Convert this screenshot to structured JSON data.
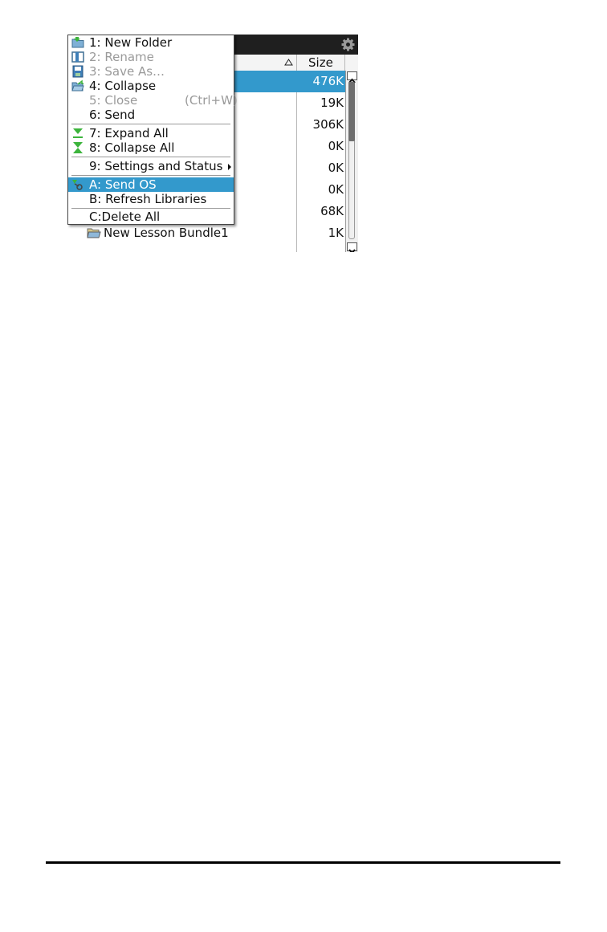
{
  "file_list": {
    "columns": {
      "size_header": "Size",
      "sort_indicator": "ascending"
    },
    "rows": [
      {
        "name": "",
        "size": "476K",
        "selected": true
      },
      {
        "name": "",
        "size": "19K",
        "selected": false
      },
      {
        "name": "",
        "size": "306K",
        "selected": false
      },
      {
        "name": "",
        "size": "0K",
        "selected": false
      },
      {
        "name": "",
        "size": "0K",
        "selected": false
      },
      {
        "name": "",
        "size": "0K",
        "selected": false
      },
      {
        "name": "",
        "size": "68K",
        "selected": false
      },
      {
        "name": "New Lesson Bundle1",
        "size": "1K",
        "selected": false
      }
    ],
    "scroll_position": 0.0
  },
  "context_menu": {
    "items": [
      {
        "label": "1: New Folder",
        "enabled": true,
        "icon": "new-folder-icon"
      },
      {
        "label": "2: Rename",
        "enabled": false,
        "icon": "rename-icon"
      },
      {
        "label": "3: Save As…",
        "enabled": false,
        "icon": "save-icon"
      },
      {
        "label": "4: Collapse",
        "enabled": true,
        "icon": "collapse-folder-icon"
      },
      {
        "label": "5: Close",
        "enabled": false,
        "shortcut": "(Ctrl+W)"
      },
      {
        "label": "6: Send",
        "enabled": true
      },
      {
        "label": "7: Expand All",
        "enabled": true,
        "icon": "expand-all-icon"
      },
      {
        "label": "8: Collapse All",
        "enabled": true,
        "icon": "collapse-all-icon"
      },
      {
        "label": "9: Settings and Status",
        "enabled": true,
        "has_submenu": true
      },
      {
        "label": "A: Send OS",
        "enabled": true,
        "highlighted": true,
        "icon": "send-os-icon"
      },
      {
        "label": "B: Refresh Libraries",
        "enabled": true
      },
      {
        "label": "C:Delete All",
        "enabled": true
      }
    ]
  },
  "colors": {
    "selection": "#3399cc",
    "title_bar": "#1f1f1f",
    "disabled_text": "#9a9a9a",
    "icon_green": "#3cb43c"
  }
}
